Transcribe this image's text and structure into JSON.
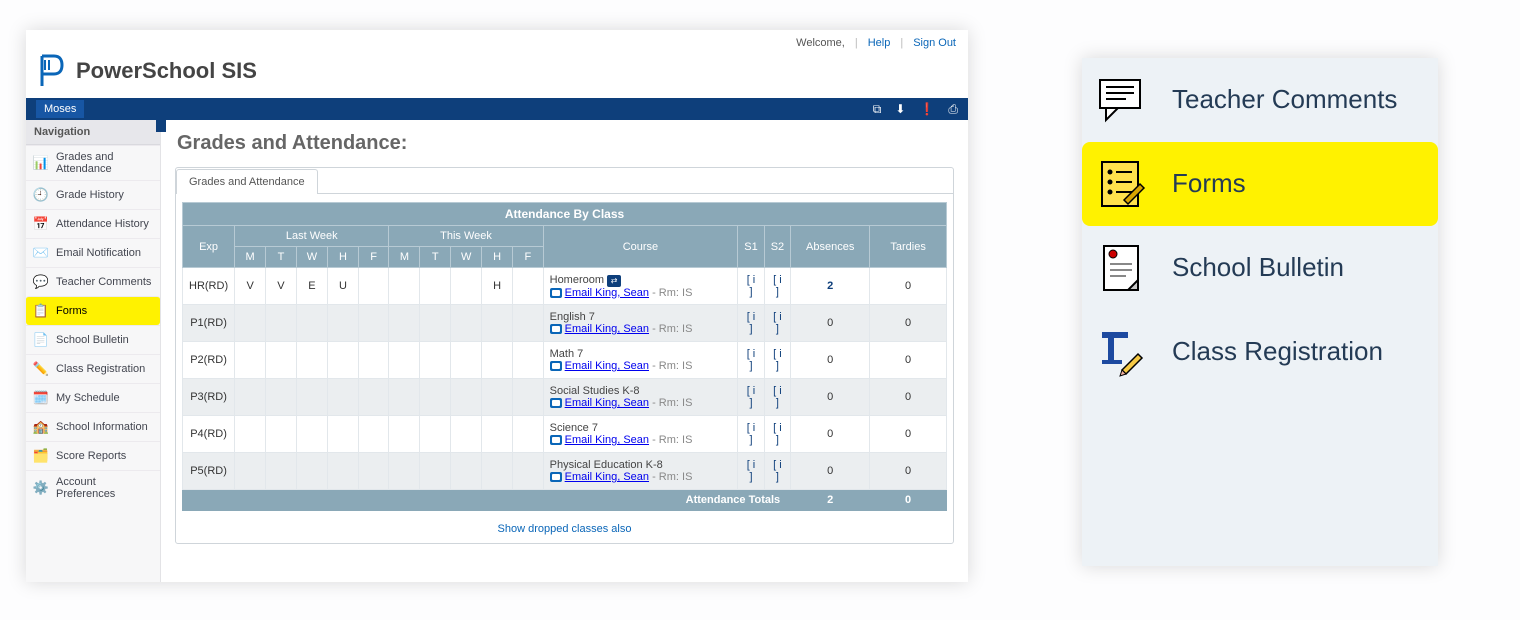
{
  "app_name": "PowerSchool SIS",
  "header": {
    "welcome_label": "Welcome,",
    "help_label": "Help",
    "signout_label": "Sign Out"
  },
  "bluebar": {
    "student_name": "Moses"
  },
  "navigation": {
    "heading": "Navigation",
    "items": [
      {
        "icon": "📊",
        "label": "Grades and Attendance"
      },
      {
        "icon": "🕘",
        "label": "Grade History"
      },
      {
        "icon": "📅",
        "label": "Attendance History"
      },
      {
        "icon": "✉️",
        "label": "Email Notification"
      },
      {
        "icon": "💬",
        "label": "Teacher Comments"
      },
      {
        "icon": "📋",
        "label": "Forms",
        "highlight": true
      },
      {
        "icon": "📄",
        "label": "School Bulletin"
      },
      {
        "icon": "✏️",
        "label": "Class Registration"
      },
      {
        "icon": "🗓️",
        "label": "My Schedule"
      },
      {
        "icon": "🏫",
        "label": "School Information"
      },
      {
        "icon": "🗂️",
        "label": "Score Reports"
      },
      {
        "icon": "⚙️",
        "label": "Account Preferences"
      }
    ]
  },
  "page": {
    "title": "Grades and Attendance:",
    "tab_label": "Grades and Attendance",
    "table_title": "Attendance By Class",
    "group_last": "Last Week",
    "group_this": "This Week",
    "col_exp": "Exp",
    "col_course": "Course",
    "col_s1": "S1",
    "col_s2": "S2",
    "col_abs": "Absences",
    "col_tardies": "Tardies",
    "days": [
      "M",
      "T",
      "W",
      "H",
      "F"
    ],
    "rows": [
      {
        "exp": "HR(RD)",
        "last": [
          "V",
          "V",
          "E",
          "U",
          ""
        ],
        "this": [
          "",
          "",
          "",
          "H",
          ""
        ],
        "course": "Homeroom",
        "has_bus": true,
        "teacher": "Email King, Sean",
        "room": "Rm: IS",
        "s1": "[ i ]",
        "s2": "[ i ]",
        "abs": "2",
        "tardies": "0",
        "abs_link": true
      },
      {
        "exp": "P1(RD)",
        "last": [
          "",
          "",
          "",
          "",
          ""
        ],
        "this": [
          "",
          "",
          "",
          "",
          ""
        ],
        "course": "English 7",
        "teacher": "Email King, Sean",
        "room": "Rm: IS",
        "s1": "[ i ]",
        "s2": "[ i ]",
        "abs": "0",
        "tardies": "0"
      },
      {
        "exp": "P2(RD)",
        "last": [
          "",
          "",
          "",
          "",
          ""
        ],
        "this": [
          "",
          "",
          "",
          "",
          ""
        ],
        "course": "Math 7",
        "teacher": "Email King, Sean",
        "room": "Rm: IS",
        "s1": "[ i ]",
        "s2": "[ i ]",
        "abs": "0",
        "tardies": "0"
      },
      {
        "exp": "P3(RD)",
        "last": [
          "",
          "",
          "",
          "",
          ""
        ],
        "this": [
          "",
          "",
          "",
          "",
          ""
        ],
        "course": "Social Studies K-8",
        "teacher": "Email King, Sean",
        "room": "Rm: IS",
        "s1": "[ i ]",
        "s2": "[ i ]",
        "abs": "0",
        "tardies": "0"
      },
      {
        "exp": "P4(RD)",
        "last": [
          "",
          "",
          "",
          "",
          ""
        ],
        "this": [
          "",
          "",
          "",
          "",
          ""
        ],
        "course": "Science 7",
        "teacher": "Email King, Sean",
        "room": "Rm: IS",
        "s1": "[ i ]",
        "s2": "[ i ]",
        "abs": "0",
        "tardies": "0"
      },
      {
        "exp": "P5(RD)",
        "last": [
          "",
          "",
          "",
          "",
          ""
        ],
        "this": [
          "",
          "",
          "",
          "",
          ""
        ],
        "course": "Physical Education K-8",
        "teacher": "Email King, Sean",
        "room": "Rm: IS",
        "s1": "[ i ]",
        "s2": "[ i ]",
        "abs": "0",
        "tardies": "0"
      }
    ],
    "totals_label": "Attendance Totals",
    "totals_abs": "2",
    "totals_tardies": "0",
    "drop_link": "Show dropped classes also"
  },
  "zoom": {
    "items": [
      {
        "label": "Teacher Comments"
      },
      {
        "label": "Forms",
        "highlight": true
      },
      {
        "label": "School Bulletin"
      },
      {
        "label": "Class Registration"
      }
    ]
  }
}
